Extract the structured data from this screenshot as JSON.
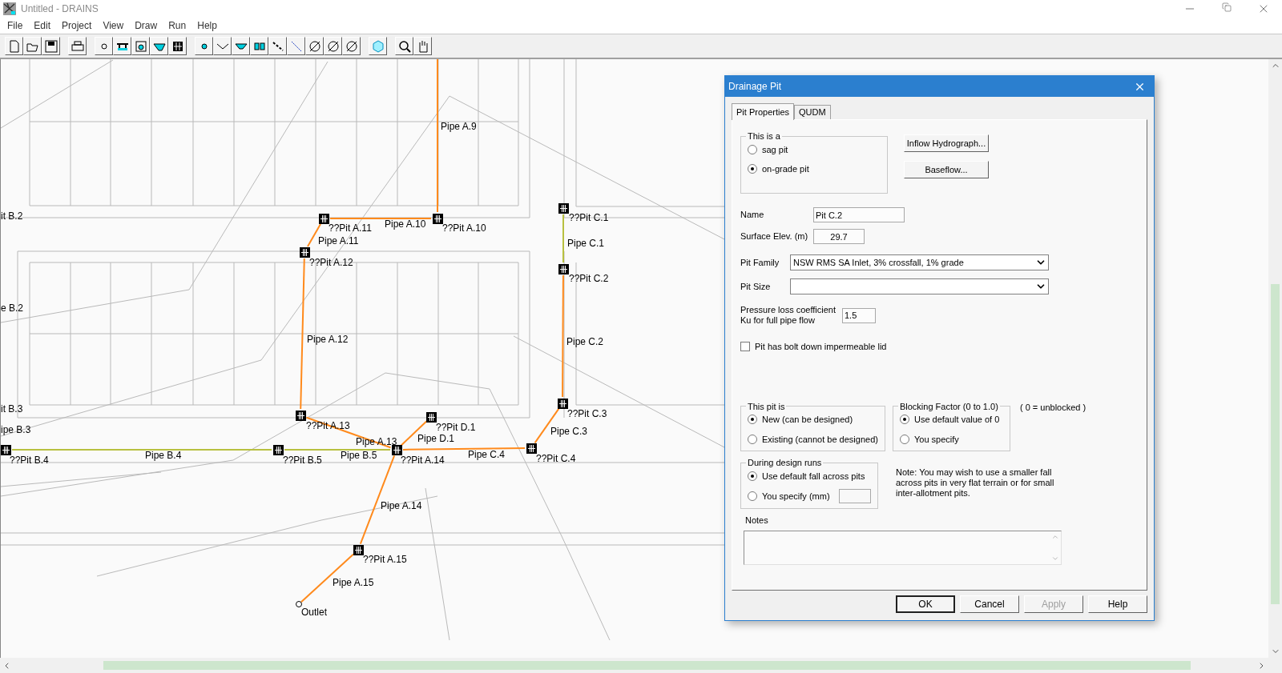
{
  "window": {
    "title": "Untitled - DRAINS"
  },
  "menu": [
    "File",
    "Edit",
    "Project",
    "View",
    "Draw",
    "Run",
    "Help"
  ],
  "canvas": {
    "edge_labels": [
      "it B.2",
      "e B.2",
      "it B.3",
      "ipe B.3"
    ],
    "pits": [
      {
        "label": "??Pit A.11"
      },
      {
        "label": "??Pit A.10"
      },
      {
        "label": "??Pit C.1"
      },
      {
        "label": "??Pit A.12"
      },
      {
        "label": "??Pit C.2"
      },
      {
        "label": "??Pit A.13"
      },
      {
        "label": "??Pit C.3"
      },
      {
        "label": "??Pit D.1"
      },
      {
        "label": "??Pit B.4"
      },
      {
        "label": "??Pit B.5"
      },
      {
        "label": "??Pit A.14"
      },
      {
        "label": "??Pit C.4"
      },
      {
        "label": "??Pit A.15"
      }
    ],
    "outlet": {
      "label": "Outlet"
    },
    "pipes": [
      {
        "label": "Pipe A.9",
        "color": "#ff8a1c"
      },
      {
        "label": "Pipe A.10",
        "color": "#ff8a1c"
      },
      {
        "label": "Pipe A.11",
        "color": "#ff8a1c"
      },
      {
        "label": "Pipe A.12",
        "color": "#ff8a1c"
      },
      {
        "label": "Pipe C.1",
        "color": "#b8c040"
      },
      {
        "label": "Pipe C.2",
        "color": "#ff8a1c"
      },
      {
        "label": "Pipe A.13",
        "color": "#ff8a1c"
      },
      {
        "label": "Pipe D.1",
        "color": "#ff8a1c"
      },
      {
        "label": "Pipe C.3",
        "color": "#ff8a1c"
      },
      {
        "label": "Pipe B.4",
        "color": "#b8c040"
      },
      {
        "label": "Pipe B.5",
        "color": "#b8c040"
      },
      {
        "label": "Pipe C.4",
        "color": "#ff8a1c"
      },
      {
        "label": "Pipe A.14",
        "color": "#ff8a1c"
      },
      {
        "label": "Pipe A.15",
        "color": "#ff8a1c"
      }
    ]
  },
  "dialog": {
    "title": "Drainage Pit",
    "tabs": [
      {
        "label": "Pit Properties",
        "selected": true
      },
      {
        "label": "QUDM",
        "selected": false
      }
    ],
    "pit_type": {
      "legend": "This is a",
      "options": [
        {
          "label": "sag pit",
          "selected": false
        },
        {
          "label": "on-grade pit",
          "selected": true
        }
      ]
    },
    "side_buttons": [
      "Inflow Hydrograph...",
      "Baseflow..."
    ],
    "name": {
      "label": "Name",
      "value": "Pit C.2"
    },
    "surface_elev": {
      "label": "Surface Elev. (m)",
      "value": "29.7"
    },
    "pit_family": {
      "label": "Pit Family",
      "value": "NSW RMS SA Inlet, 3% crossfall, 1% grade"
    },
    "pit_size": {
      "label": "Pit Size"
    },
    "pressure_loss": {
      "label_lines": [
        "Pressure loss coefficient",
        "Ku for full pipe flow"
      ],
      "value": "1.5"
    },
    "bolt_lid": {
      "label": "Pit has bolt down impermeable lid",
      "checked": false
    },
    "pit_status": {
      "legend": "This pit is",
      "options": [
        {
          "label": "New (can be designed)",
          "selected": true
        },
        {
          "label": "Existing (cannot be designed)",
          "selected": false
        }
      ]
    },
    "blocking": {
      "legend": "Blocking Factor (0 to 1.0)",
      "hint": "( 0 = unblocked )",
      "options": [
        {
          "label": "Use default value of 0",
          "selected": true
        },
        {
          "label": "You specify",
          "selected": false
        }
      ]
    },
    "design_runs": {
      "legend": "During design runs",
      "options": [
        {
          "label": "Use default fall across pits",
          "selected": true
        },
        {
          "label": "You specify (mm)",
          "selected": false
        }
      ]
    },
    "note_lines": [
      "Note: You may wish to use a smaller fall",
      "across pits in very flat terrain or for small",
      "inter-allotment pits."
    ],
    "notes": {
      "label": "Notes"
    },
    "buttons": [
      {
        "label": "OK",
        "default": true,
        "disabled": false
      },
      {
        "label": "Cancel",
        "default": false,
        "disabled": false
      },
      {
        "label": "Apply",
        "default": false,
        "disabled": true
      },
      {
        "label": "Help",
        "default": false,
        "disabled": false
      }
    ]
  }
}
